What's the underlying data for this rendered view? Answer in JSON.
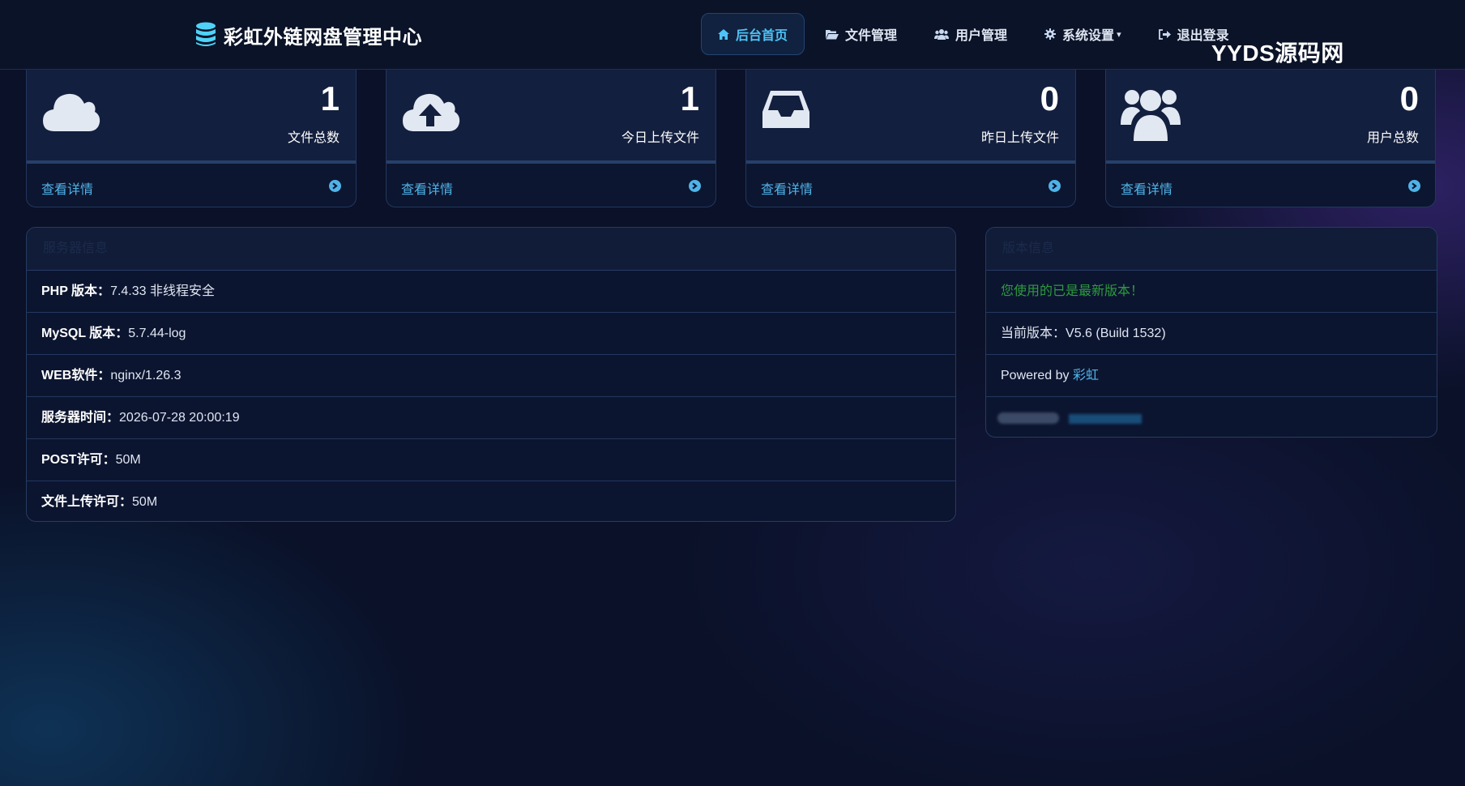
{
  "brand": {
    "title": "彩虹外链网盘管理中心",
    "icon": "database-icon"
  },
  "nav": {
    "items": [
      {
        "label": "后台首页",
        "icon": "home-icon",
        "active": true
      },
      {
        "label": "文件管理",
        "icon": "folder-icon"
      },
      {
        "label": "用户管理",
        "icon": "users-icon"
      },
      {
        "label": "系统设置",
        "icon": "gear-icon",
        "dropdown": true
      },
      {
        "label": "退出登录",
        "icon": "logout-icon"
      }
    ]
  },
  "watermark": "YYDS源码网",
  "stats": [
    {
      "value": "1",
      "label": "文件总数",
      "link": "查看详情",
      "icon": "cloud-icon"
    },
    {
      "value": "1",
      "label": "今日上传文件",
      "link": "查看详情",
      "icon": "cloud-upload-icon"
    },
    {
      "value": "0",
      "label": "昨日上传文件",
      "link": "查看详情",
      "icon": "inbox-icon"
    },
    {
      "value": "0",
      "label": "用户总数",
      "link": "查看详情",
      "icon": "users-icon"
    }
  ],
  "server_panel": {
    "title": "服务器信息",
    "rows": [
      {
        "key": "PHP 版本：",
        "value": "7.4.33 非线程安全"
      },
      {
        "key": "MySQL 版本：",
        "value": "5.7.44-log"
      },
      {
        "key": "WEB软件：",
        "value": "nginx/1.26.3"
      },
      {
        "key": "服务器时间：",
        "value": "2026-07-28 20:00:19"
      },
      {
        "key": "POST许可：",
        "value": "50M"
      },
      {
        "key": "文件上传许可：",
        "value": "50M"
      }
    ]
  },
  "version_panel": {
    "title": "版本信息",
    "latest_msg": "您使用的已是最新版本！",
    "current_label": "当前版本：",
    "current_value": "V5.6 (Build 1532)",
    "powered_prefix": "Powered by ",
    "powered_link": "彩虹"
  },
  "colors": {
    "accent": "#4fc3f7",
    "link": "#4fb3e8",
    "success": "#2e9a3e",
    "background": "#0a1128"
  }
}
